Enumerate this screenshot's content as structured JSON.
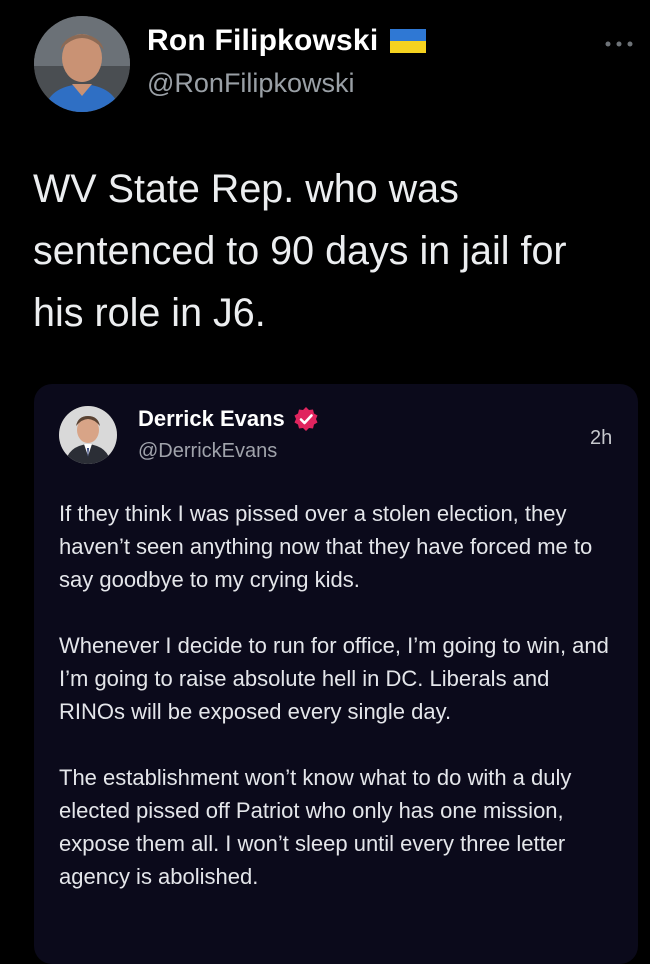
{
  "tweet": {
    "author": {
      "name": "Ron Filipkowski",
      "handle": "@RonFilipkowski",
      "flag_icon": "ukraine-flag-icon"
    },
    "more_icon": "more-horizontal-icon",
    "text": "WV State Rep. who was sentenced to 90 days in jail for his role in J6."
  },
  "quote": {
    "author": {
      "name": "Derrick Evans",
      "handle": "@DerrickEvans",
      "badge_icon": "verified-badge-icon",
      "badge_color": "#e0245e"
    },
    "time": "2h",
    "paragraphs": [
      "If they think I was pissed over a stolen election, they haven’t seen anything now that they have forced me to say goodbye to my crying kids.",
      "Whenever I decide to run for office, I’m going to win, and I’m going to raise absolute hell in DC. Liberals and RINOs will be exposed every single day.",
      "The establishment won’t know what to do with a duly elected pissed off Patriot who only has one mission, expose them all. I won’t sleep until every three letter agency is abolished."
    ]
  },
  "colors": {
    "background": "#000000",
    "card_background": "#0b0a1b",
    "text_primary": "#e7e9ea",
    "text_secondary": "#9aa0a6"
  }
}
